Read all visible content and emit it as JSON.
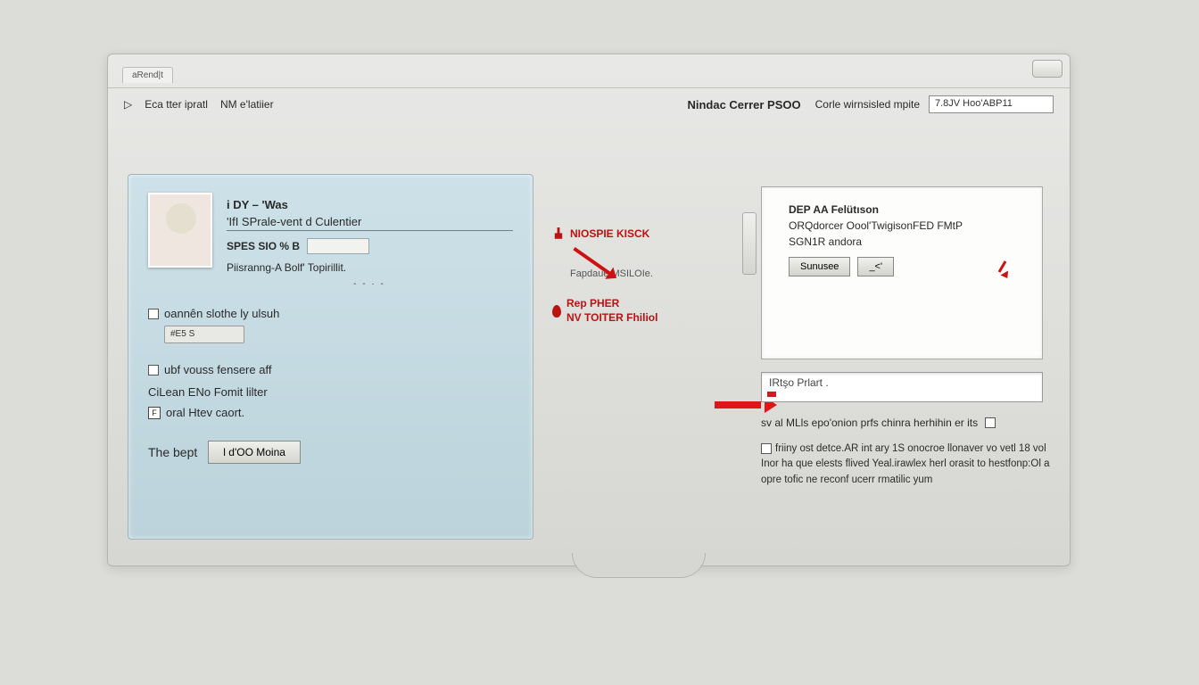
{
  "titlebar": {
    "tab1": "aRend|t"
  },
  "header": {
    "left_link1": "Eca tter ipratl",
    "left_link2": "NM e'latiier",
    "center_title": "Nindac Cerrer PSOO",
    "right_label": "Corle wirnsisled mpite",
    "right_value": "7.8JV Hoo'ABP11"
  },
  "left": {
    "name_line": "i DY – 'Was",
    "role_line": "'IfI SPrale-vent d Culentier",
    "spes_label": "SPES SIO % B",
    "fifth_line": "Piisranng-A Bolf' Topirillit.",
    "mid_check_label": "oannên slothe ly ulsuh",
    "mid_pill": "#E5 S",
    "low_line1": "ubf vouss fensere aff",
    "low_line2": "CiLеan ENo Fomit lilter",
    "low_line3": "oral Htev caort.",
    "foot_label": "The bept",
    "foot_button": "l d'OO Moina"
  },
  "center": {
    "item1": "NIOSPIE KISCK",
    "item1_sub": "Fapdaue MSILOIe.",
    "item2a": "Rep PHER",
    "item2b": "NV TOITER Fhiliol"
  },
  "right": {
    "pane_l1": "DEP AA Felütıson",
    "pane_l2": "ORQdorcer Oool'TwigisonFED FMtP",
    "pane_l3": "SGN1R andora",
    "btn1": "Sunusee",
    "btn2": "_<'",
    "field_text": "IRtşo Prlart .",
    "check_text": "sv al MLls epo'onion prfs chinra herhihin er its",
    "para": "friiny ost detce.AR int ary 1S onocroe llonaver vo vetl 18 vol Inor ha que elests flived Yeal.irawlex herl orasit to hestfonp:Ol a opre tofic ne reconf ucerr rmatilic yum"
  }
}
